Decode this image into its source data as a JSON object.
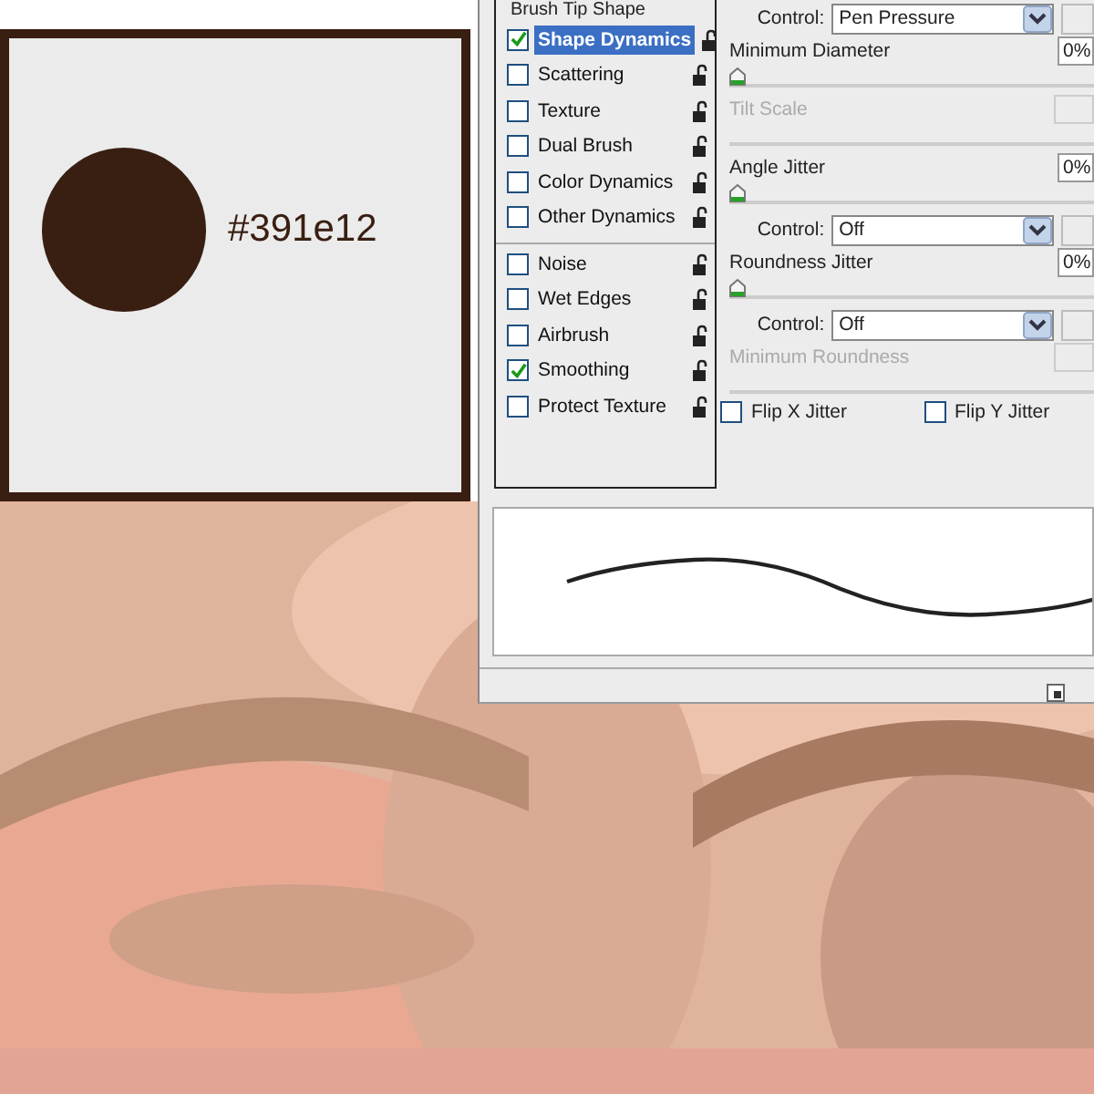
{
  "swatch": {
    "color": "#391e12",
    "label": "#391e12"
  },
  "brush_panel": {
    "header": "Brush Tip Shape",
    "option_groups": [
      [
        {
          "label": "Shape Dynamics",
          "checked": true,
          "selected": true
        },
        {
          "label": "Scattering",
          "checked": false,
          "selected": false
        },
        {
          "label": "Texture",
          "checked": false,
          "selected": false
        },
        {
          "label": "Dual Brush",
          "checked": false,
          "selected": false
        },
        {
          "label": "Color Dynamics",
          "checked": false,
          "selected": false
        },
        {
          "label": "Other Dynamics",
          "checked": false,
          "selected": false
        }
      ],
      [
        {
          "label": "Noise",
          "checked": false,
          "selected": false
        },
        {
          "label": "Wet Edges",
          "checked": false,
          "selected": false
        },
        {
          "label": "Airbrush",
          "checked": false,
          "selected": false
        },
        {
          "label": "Smoothing",
          "checked": true,
          "selected": false
        },
        {
          "label": "Protect Texture",
          "checked": false,
          "selected": false
        }
      ]
    ],
    "settings": [
      {
        "kind": "dropdown",
        "label": "Control:",
        "value": "Pen Pressure"
      },
      {
        "kind": "slider",
        "label": "Minimum Diameter",
        "value": "0%",
        "level": 0,
        "disabled": false
      },
      {
        "kind": "slider",
        "label": "Tilt Scale",
        "disabled": true
      },
      {
        "kind": "slider",
        "label": "Angle Jitter",
        "value": "0%",
        "level": 0,
        "disabled": false
      },
      {
        "kind": "dropdown",
        "label": "Control:",
        "value": "Off"
      },
      {
        "kind": "slider",
        "label": "Roundness Jitter",
        "value": "0%",
        "level": 0,
        "disabled": false
      },
      {
        "kind": "dropdown",
        "label": "Control:",
        "value": "Off"
      },
      {
        "kind": "slider",
        "label": "Minimum Roundness",
        "disabled": true
      }
    ],
    "flips": [
      {
        "label": "Flip X Jitter",
        "checked": false
      },
      {
        "label": "Flip Y Jitter",
        "checked": false
      }
    ]
  }
}
